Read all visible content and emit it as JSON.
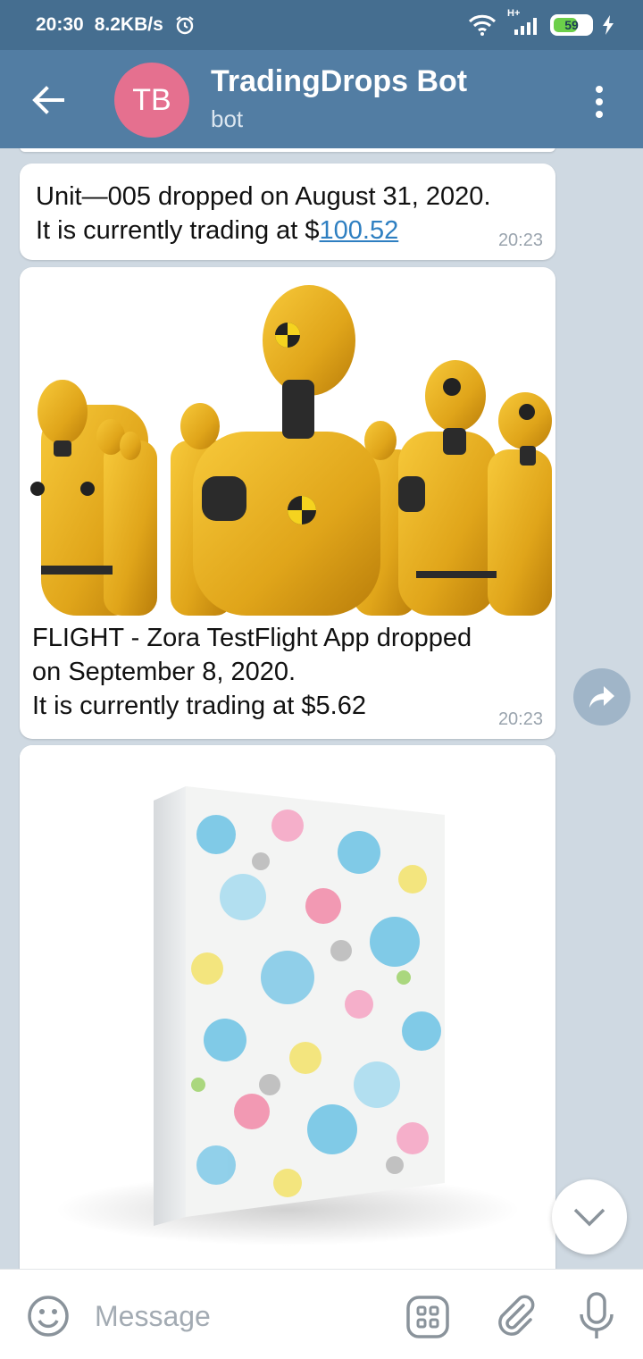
{
  "status_bar": {
    "time": "20:30",
    "speed": "8.2KB/s",
    "battery": "59",
    "network": "H+"
  },
  "header": {
    "avatar_initials": "TB",
    "avatar_color": "#e5708f",
    "title": "TradingDrops Bot",
    "subtitle": "bot"
  },
  "messages": [
    {
      "line1": "Unit—005 dropped on August 31, 2020.",
      "line2_prefix": "It is currently trading at $",
      "price_link": "100.52",
      "time": "20:23"
    },
    {
      "image": "crash-test-dummies-photo",
      "line1": "FLIGHT - Zora TestFlight App dropped",
      "line2": "on September 8, 2020.",
      "line3": "It is currently trading at $5.62",
      "time": "20:23"
    },
    {
      "image": "paint-splatter-box-photo"
    }
  ],
  "input": {
    "placeholder": "Message"
  },
  "colors": {
    "header_bg": "#527da3",
    "status_bg": "#456e90",
    "chat_bg": "#cfd9e2",
    "link": "#2e7fc1"
  },
  "icons": [
    "back-arrow-icon",
    "more-vert-icon",
    "share-icon",
    "chevron-down-icon",
    "emoji-icon",
    "bot-commands-icon",
    "attach-icon",
    "mic-icon",
    "alarm-icon",
    "wifi-icon",
    "signal-icon",
    "charging-icon"
  ]
}
